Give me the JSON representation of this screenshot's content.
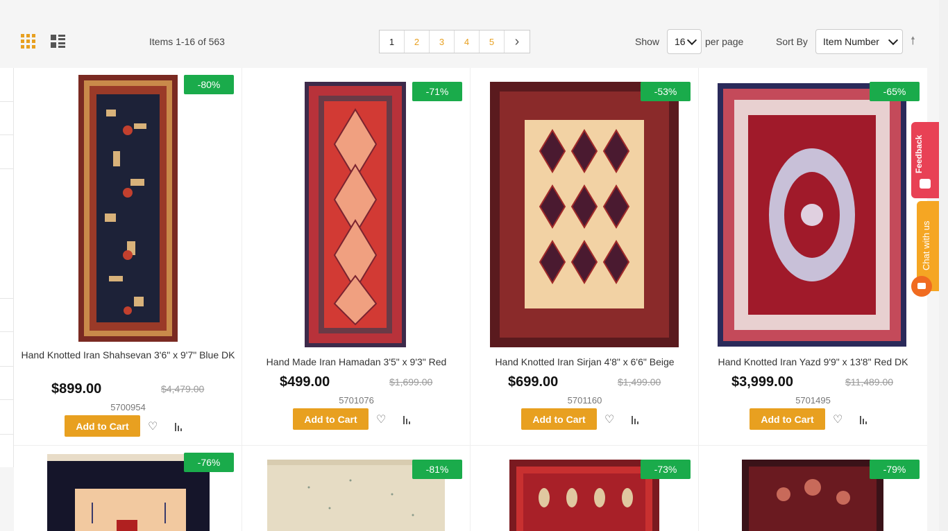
{
  "toolbar": {
    "items_count": "Items 1-16 of 563",
    "pages": [
      "1",
      "2",
      "3",
      "4",
      "5"
    ],
    "active_page": "1",
    "show_label": "Show",
    "show_value": "16",
    "per_page_label": "per page",
    "sort_label": "Sort By",
    "sort_value": "Item Number",
    "sort_direction_icon": "arrow-up-icon",
    "accent_color": "#e8a020"
  },
  "products": [
    {
      "badge": "-80%",
      "title": "Hand Knotted Iran Shahsevan 3'6\" x 9'7\" Blue DK",
      "price": "$899.00",
      "old_price": "$4,479.00",
      "sku": "5700954",
      "cart_label": "Add to Cart"
    },
    {
      "badge": "-71%",
      "title": "Hand Made Iran Hamadan 3'5\" x 9'3\" Red",
      "price": "$499.00",
      "old_price": "$1,699.00",
      "sku": "5701076",
      "cart_label": "Add to Cart"
    },
    {
      "badge": "-53%",
      "title": "Hand Knotted Iran Sirjan 4'8\" x 6'6\" Beige",
      "price": "$699.00",
      "old_price": "$1,499.00",
      "sku": "5701160",
      "cart_label": "Add to Cart"
    },
    {
      "badge": "-65%",
      "title": "Hand Knotted Iran Yazd 9'9\" x 13'8\" Red DK",
      "price": "$3,999.00",
      "old_price": "$11,489.00",
      "sku": "5701495",
      "cart_label": "Add to Cart"
    },
    {
      "badge": "-76%"
    },
    {
      "badge": "-81%"
    },
    {
      "badge": "-73%"
    },
    {
      "badge": "-79%"
    }
  ],
  "side_widgets": {
    "feedback_label": "Feedback",
    "chat_label": "Chat with us"
  },
  "colors": {
    "badge_green": "#1aab4b",
    "cart_orange": "#e8a020",
    "feedback_red": "#e84155",
    "chat_orange": "#f5a623"
  }
}
